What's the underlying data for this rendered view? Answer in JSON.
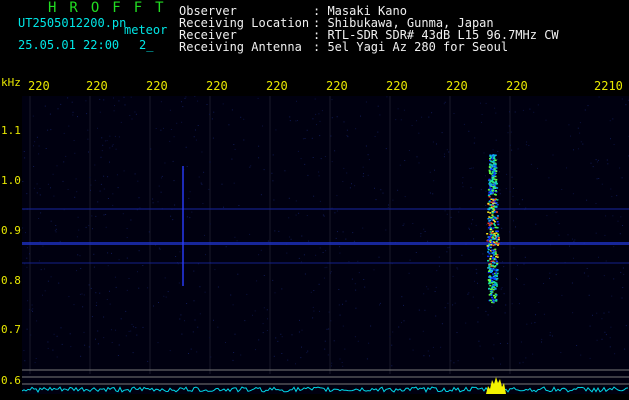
{
  "header": {
    "app_title": "HROFFT",
    "filename": "UT2505012200.pn",
    "tag": "meteor",
    "datetime": "25.05.01 22:00",
    "counter": "2_",
    "info": [
      {
        "label": "Observer",
        "value": ": Masaki Kano"
      },
      {
        "label": "Receiving Location",
        "value": ": Shibukawa, Gunma, Japan"
      },
      {
        "label": "Receiver",
        "value": ": RTL-SDR SDR# 43dB L15 96.7MHz CW"
      },
      {
        "label": "Receiving Antenna",
        "value": ": 5el Yagi Az 280 for Seoul"
      }
    ]
  },
  "axis": {
    "y_unit": "kHz",
    "x_ticks": [
      "220",
      "220",
      "220",
      "220",
      "220",
      "220",
      "220",
      "220",
      "220",
      "2210"
    ],
    "y_ticks": [
      "1.1",
      "1.0",
      "0.9",
      "0.8",
      "0.7",
      "0.6"
    ]
  },
  "colors": {
    "title": "#22dd22",
    "header_text": "#00e6e6",
    "tick_text": "#e8e800",
    "signal_band": "#2a3cff",
    "meteor_core": "#ff3030"
  }
}
